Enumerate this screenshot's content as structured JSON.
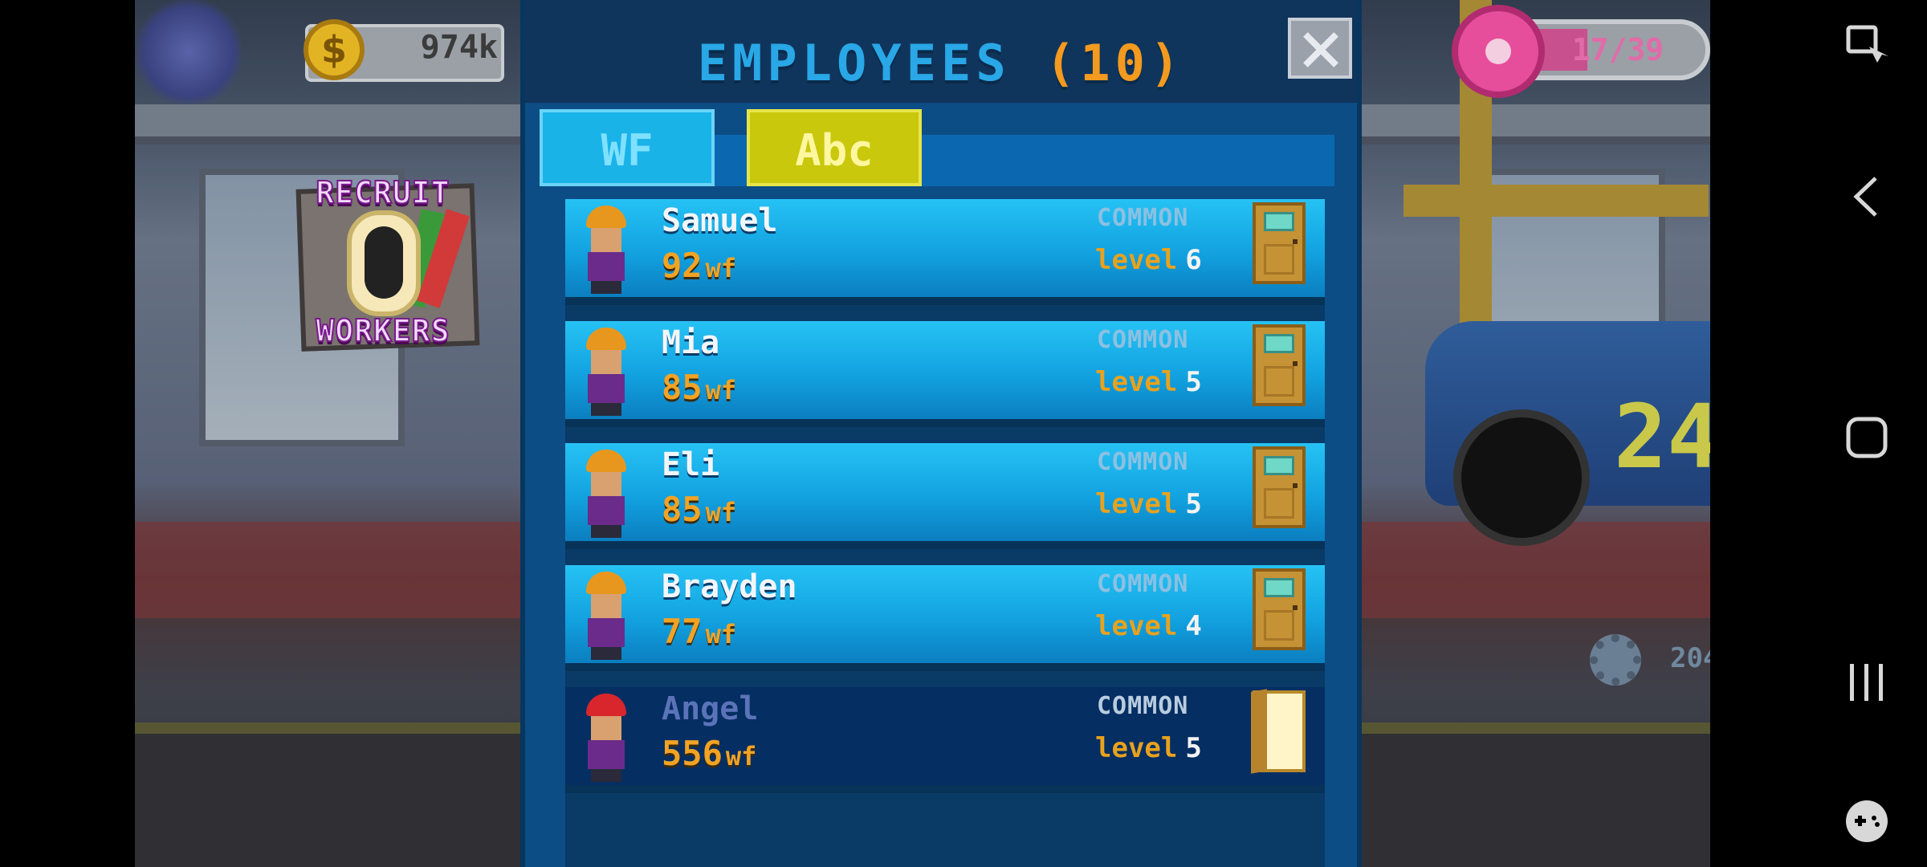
{
  "hud": {
    "coins": "974k",
    "coin_symbol": "$",
    "donuts": "17/39",
    "donut_fraction": 0.44,
    "gear_value": "204",
    "car_number": "24",
    "recruit_line1": "RECRUIT",
    "recruit_line2": "WORKERS"
  },
  "modal": {
    "title": "EMPLOYEES",
    "count": "(10)",
    "tabs": [
      {
        "label": "WF",
        "color": "#1ab3e8"
      },
      {
        "label": "Abc",
        "color": "#c9c80c"
      }
    ]
  },
  "employees": [
    {
      "name": "Samuel",
      "wf": "92",
      "unit": "wf",
      "rarity": "COMMON",
      "level_label": "level",
      "level": "6",
      "state": "active",
      "helmet": "#e8971e"
    },
    {
      "name": "Mia",
      "wf": "85",
      "unit": "wf",
      "rarity": "COMMON",
      "level_label": "level",
      "level": "5",
      "state": "active",
      "helmet": "#e8971e"
    },
    {
      "name": "Eli",
      "wf": "85",
      "unit": "wf",
      "rarity": "COMMON",
      "level_label": "level",
      "level": "5",
      "state": "active",
      "helmet": "#e8971e"
    },
    {
      "name": "Brayden",
      "wf": "77",
      "unit": "wf",
      "rarity": "COMMON",
      "level_label": "level",
      "level": "4",
      "state": "active",
      "helmet": "#e8971e"
    },
    {
      "name": "Angel",
      "wf": "556",
      "unit": "wf",
      "rarity": "COMMON",
      "level_label": "level",
      "level": "5",
      "state": "inactive",
      "helmet": "#d8262c"
    }
  ],
  "colors": {
    "accent_title": "#29a7e6",
    "count": "#f39a1f",
    "modal_bg": "#0d4d85"
  }
}
